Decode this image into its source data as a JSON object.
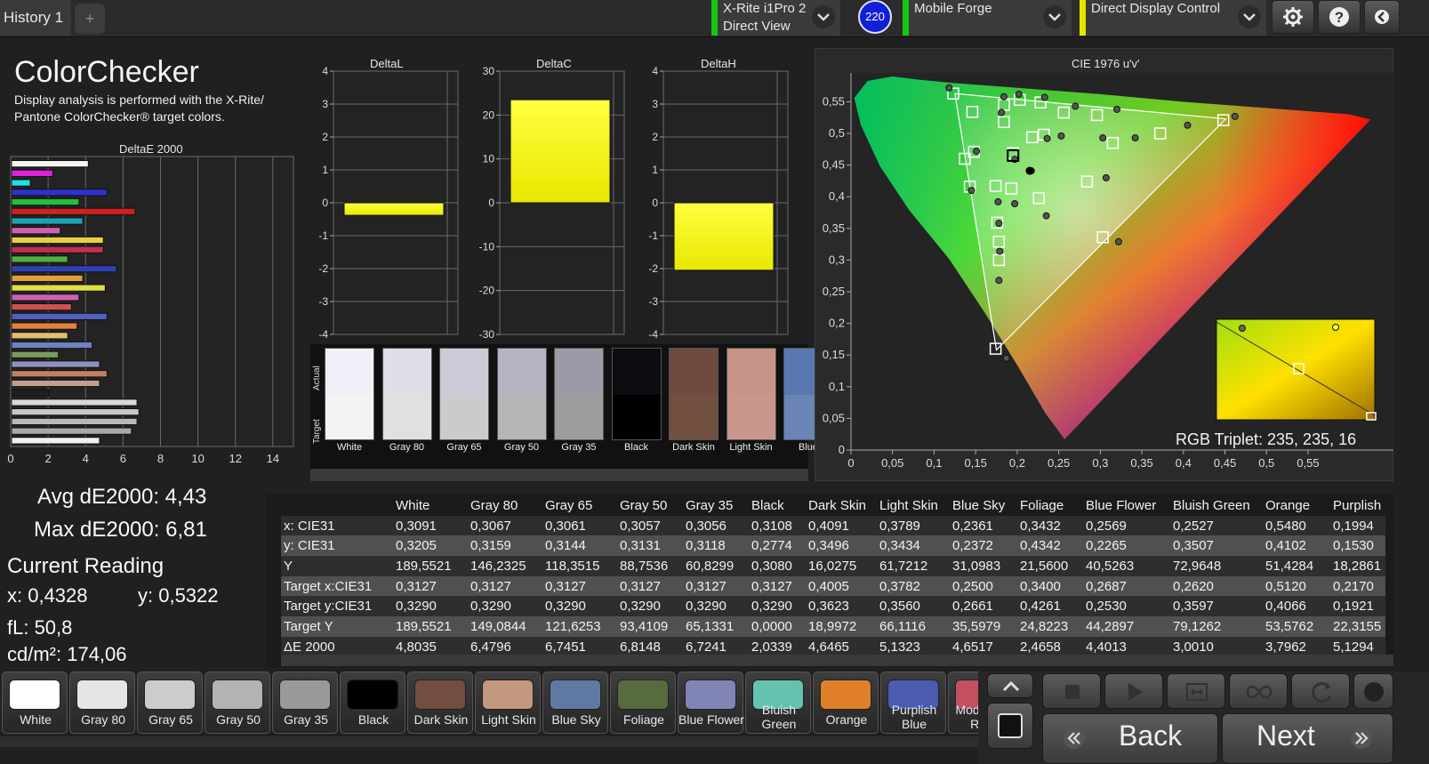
{
  "top": {
    "history_tab": "History 1",
    "add_tab": "+",
    "instrument": {
      "line1": "X-Rite i1Pro 2",
      "line2": "Direct View"
    },
    "badge": "220",
    "display": "Mobile Forge",
    "workflow": "Direct Display Control",
    "status_green": "#14c814",
    "status_yellow": "#e6e600"
  },
  "left": {
    "title": "ColorChecker",
    "description": "Display analysis is performed with the X-Rite/ Pantone ColorChecker® target colors.",
    "deltae_title": "DeltaE 2000",
    "avg": "Avg dE2000: 4,43",
    "max": "Max dE2000: 6,81",
    "current_reading": "Current Reading",
    "x": "x: 0,4328",
    "y": "y: 0,5322",
    "fl": "fL: 50,8",
    "cdm": "cd/m²: 174,06"
  },
  "deltae_chart": {
    "type": "bar",
    "orientation": "horizontal",
    "xlim": [
      0,
      15
    ],
    "ticks": [
      "0",
      "2",
      "4",
      "6",
      "8",
      "10",
      "12",
      "14"
    ],
    "values": [
      4.1,
      2.2,
      1.0,
      5.1,
      3.6,
      6.6,
      3.8,
      2.6,
      4.9,
      4.9,
      3.0,
      5.6,
      3.8,
      5.0,
      3.6,
      3.2,
      5.1,
      3.5,
      3.0,
      4.3,
      2.5,
      4.7,
      5.1,
      4.7,
      2.0,
      6.7,
      6.8,
      6.7,
      6.4,
      4.7
    ],
    "colors": [
      "#f5f5f0",
      "#e020e0",
      "#20e0e0",
      "#3030d0",
      "#20c040",
      "#d02020",
      "#20a0b0",
      "#d060b0",
      "#e8d040",
      "#c03050",
      "#50b040",
      "#3040b0",
      "#e0a040",
      "#e0e040",
      "#d060b0",
      "#d05050",
      "#5060c0",
      "#e08040",
      "#e0c070",
      "#7080c0",
      "#7a9a60",
      "#9090c0",
      "#c08060",
      "#c0a090",
      "#202020",
      "#d8d8d8",
      "#c8c8c8",
      "#b8b8b8",
      "#a8a8a8",
      "#f0f0f0"
    ]
  },
  "delta_charts": [
    {
      "title": "DeltaL",
      "ticks": [
        "4",
        "3",
        "2",
        "1",
        "0",
        "-1",
        "-2",
        "-3",
        "-4"
      ],
      "ylim": [
        -4,
        4
      ],
      "value": -0.38
    },
    {
      "title": "DeltaC",
      "ticks": [
        "30",
        "20",
        "10",
        "0",
        "-10",
        "-20",
        "-30"
      ],
      "ylim": [
        -30,
        30
      ],
      "value": 23.5
    },
    {
      "title": "DeltaH",
      "ticks": [
        "4",
        "3",
        "2",
        "1",
        "0",
        "-1",
        "-2",
        "-3",
        "-4"
      ],
      "ylim": [
        -4,
        4
      ],
      "value": -2.05
    }
  ],
  "patches": {
    "actual_label": "Actual",
    "target_label": "Target",
    "items": [
      {
        "name": "White",
        "actual": "#f2eff8",
        "target": "#f3f3f3"
      },
      {
        "name": "Gray 80",
        "actual": "#e0dde8",
        "target": "#e0e0e0"
      },
      {
        "name": "Gray 65",
        "actual": "#cdc9d6",
        "target": "#cbcbcb"
      },
      {
        "name": "Gray 50",
        "actual": "#b7b3c2",
        "target": "#b6b6b6"
      },
      {
        "name": "Gray 35",
        "actual": "#9d99a6",
        "target": "#9d9d9d"
      },
      {
        "name": "Black",
        "actual": "#0d0c10",
        "target": "#000000"
      },
      {
        "name": "Dark Skin",
        "actual": "#6e4a40",
        "target": "#72503f"
      },
      {
        "name": "Light Skin",
        "actual": "#c89488",
        "target": "#c8968a"
      },
      {
        "name": "Blue",
        "actual": "#5a78b0",
        "target": "#6a85b5"
      }
    ]
  },
  "cie": {
    "title": "CIE 1976 u'v'",
    "xticks": [
      "0",
      "0,05",
      "0,1",
      "0,15",
      "0,2",
      "0,25",
      "0,3",
      "0,35",
      "0,4",
      "0,45",
      "0,5",
      "0,55"
    ],
    "yticks": [
      "0,55",
      "0,5",
      "0,45",
      "0,4",
      "0,35",
      "0,3",
      "0,25",
      "0,2",
      "0,15",
      "0,1",
      "0,05",
      "0"
    ],
    "rgb_triplet": "RGB Triplet: 235, 235, 16",
    "targets": [
      [
        0.123,
        0.563
      ],
      [
        0.146,
        0.534
      ],
      [
        0.184,
        0.518
      ],
      [
        0.184,
        0.545
      ],
      [
        0.203,
        0.553
      ],
      [
        0.228,
        0.549
      ],
      [
        0.256,
        0.533
      ],
      [
        0.296,
        0.529
      ],
      [
        0.372,
        0.5
      ],
      [
        0.448,
        0.521
      ],
      [
        0.232,
        0.498
      ],
      [
        0.315,
        0.485
      ],
      [
        0.218,
        0.494
      ],
      [
        0.137,
        0.46
      ],
      [
        0.148,
        0.471
      ],
      [
        0.195,
        0.469
      ],
      [
        0.143,
        0.416
      ],
      [
        0.174,
        0.417
      ],
      [
        0.193,
        0.413
      ],
      [
        0.226,
        0.398
      ],
      [
        0.284,
        0.424
      ],
      [
        0.176,
        0.359
      ],
      [
        0.178,
        0.3
      ],
      [
        0.303,
        0.336
      ],
      [
        0.174,
        0.16
      ],
      [
        0.178,
        0.329
      ]
    ],
    "measured": [
      [
        0.118,
        0.572
      ],
      [
        0.184,
        0.558
      ],
      [
        0.202,
        0.562
      ],
      [
        0.233,
        0.557
      ],
      [
        0.27,
        0.543
      ],
      [
        0.32,
        0.538
      ],
      [
        0.462,
        0.527
      ],
      [
        0.405,
        0.513
      ],
      [
        0.342,
        0.493
      ],
      [
        0.303,
        0.493
      ],
      [
        0.253,
        0.496
      ],
      [
        0.236,
        0.492
      ],
      [
        0.181,
        0.533
      ],
      [
        0.151,
        0.472
      ],
      [
        0.197,
        0.459
      ],
      [
        0.217,
        0.441
      ],
      [
        0.307,
        0.43
      ],
      [
        0.145,
        0.41
      ],
      [
        0.177,
        0.392
      ],
      [
        0.197,
        0.389
      ],
      [
        0.235,
        0.37
      ],
      [
        0.178,
        0.358
      ],
      [
        0.179,
        0.314
      ],
      [
        0.322,
        0.329
      ],
      [
        0.178,
        0.268
      ],
      [
        0.187,
        0.145
      ]
    ],
    "white_point": [
      0.195,
      0.465
    ],
    "current": [
      0.215,
      0.441
    ]
  },
  "table": {
    "columns": [
      "",
      "White",
      "Gray 80",
      "Gray 65",
      "Gray 50",
      "Gray 35",
      "Black",
      "Dark Skin",
      "Light Skin",
      "Blue Sky",
      "Foliage",
      "Blue Flower",
      "Bluish Green",
      "Orange",
      "Purplish"
    ],
    "rows": [
      [
        "x: CIE31",
        "0,3091",
        "0,3067",
        "0,3061",
        "0,3057",
        "0,3056",
        "0,3108",
        "0,4091",
        "0,3789",
        "0,2361",
        "0,3432",
        "0,2569",
        "0,2527",
        "0,5480",
        "0,1994"
      ],
      [
        "y: CIE31",
        "0,3205",
        "0,3159",
        "0,3144",
        "0,3131",
        "0,3118",
        "0,2774",
        "0,3496",
        "0,3434",
        "0,2372",
        "0,4342",
        "0,2265",
        "0,3507",
        "0,4102",
        "0,1530"
      ],
      [
        "Y",
        "189,5521",
        "146,2325",
        "118,3515",
        "88,7536",
        "60,8299",
        "0,3080",
        "16,0275",
        "61,7212",
        "31,0983",
        "21,5600",
        "40,5263",
        "72,9648",
        "51,4284",
        "18,2861"
      ],
      [
        "Target x:CIE31",
        "0,3127",
        "0,3127",
        "0,3127",
        "0,3127",
        "0,3127",
        "0,3127",
        "0,4005",
        "0,3782",
        "0,2500",
        "0,3400",
        "0,2687",
        "0,2620",
        "0,5120",
        "0,2170"
      ],
      [
        "Target y:CIE31",
        "0,3290",
        "0,3290",
        "0,3290",
        "0,3290",
        "0,3290",
        "0,3290",
        "0,3623",
        "0,3560",
        "0,2661",
        "0,4261",
        "0,2530",
        "0,3597",
        "0,4066",
        "0,1921"
      ],
      [
        "Target Y",
        "189,5521",
        "149,0844",
        "121,6253",
        "93,4109",
        "65,1331",
        "0,0000",
        "18,9972",
        "66,1116",
        "35,5979",
        "24,8223",
        "44,2897",
        "79,1262",
        "53,5762",
        "22,3155"
      ],
      [
        "ΔE 2000",
        "4,8035",
        "6,4796",
        "6,7451",
        "6,8148",
        "6,7241",
        "2,0339",
        "4,6465",
        "5,1323",
        "4,6517",
        "2,4658",
        "4,4013",
        "3,0010",
        "3,7962",
        "5,1294"
      ]
    ]
  },
  "swatches": [
    {
      "label": "White",
      "color": "#ffffff"
    },
    {
      "label": "Gray 80",
      "color": "#e5e5e5"
    },
    {
      "label": "Gray 65",
      "color": "#cccccc"
    },
    {
      "label": "Gray 50",
      "color": "#b3b3b3"
    },
    {
      "label": "Gray 35",
      "color": "#999999"
    },
    {
      "label": "Black",
      "color": "#000000"
    },
    {
      "label": "Dark Skin",
      "color": "#734d40"
    },
    {
      "label": "Light Skin",
      "color": "#c4977f"
    },
    {
      "label": "Blue Sky",
      "color": "#5e7aa3"
    },
    {
      "label": "Foliage",
      "color": "#566b3e"
    },
    {
      "label": "Blue Flower",
      "color": "#8185b5"
    },
    {
      "label": "Bluish Green",
      "color": "#65c2b0"
    },
    {
      "label": "Orange",
      "color": "#e0802a"
    },
    {
      "label": "Purplish Blue",
      "color": "#4a5bb0"
    },
    {
      "label": "Moderate Red",
      "color": "#c45162"
    }
  ],
  "nav": {
    "back": "Back",
    "next": "Next"
  }
}
